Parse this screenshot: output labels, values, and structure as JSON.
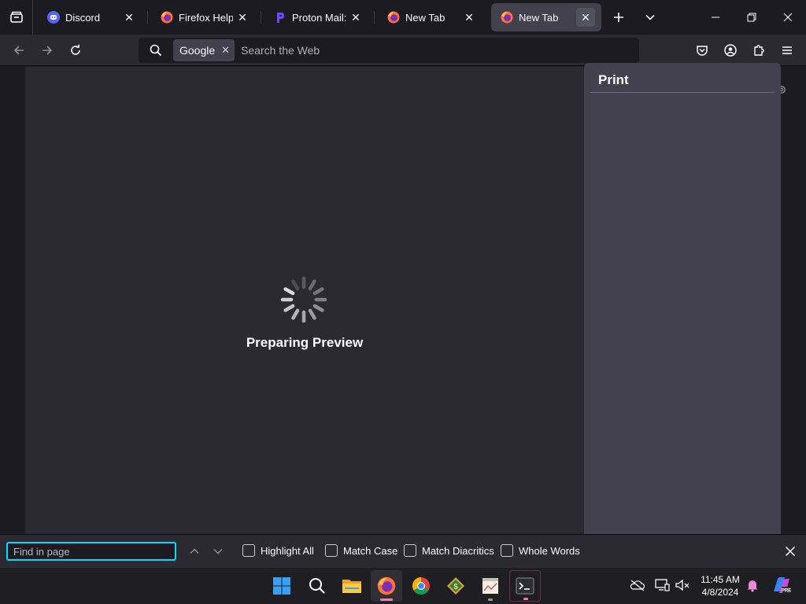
{
  "tabs": [
    {
      "title": "Discord",
      "icon": "discord-icon",
      "active": false
    },
    {
      "title": "Firefox Help",
      "icon": "firefox-icon",
      "active": false
    },
    {
      "title": "Proton Mail: Sig",
      "icon": "proton-icon",
      "active": false
    },
    {
      "title": "New Tab",
      "icon": "firefox-icon",
      "active": false
    },
    {
      "title": "New Tab",
      "icon": "firefox-icon",
      "active": true
    }
  ],
  "urlbar": {
    "engine": "Google",
    "placeholder": "Search the Web"
  },
  "print_panel": {
    "title": "Print"
  },
  "preview": {
    "status": "Preparing Preview"
  },
  "findbar": {
    "placeholder": "Find in page",
    "options": [
      {
        "label": "Highlight All",
        "checked": false
      },
      {
        "label": "Match Case",
        "checked": false
      },
      {
        "label": "Match Diacritics",
        "checked": false
      },
      {
        "label": "Whole Words",
        "checked": false
      }
    ]
  },
  "taskbar": {
    "apps": [
      "windows-start-icon",
      "search-icon",
      "file-explorer-icon",
      "firefox-icon",
      "chrome-icon",
      "money-app-icon",
      "notepad-icon",
      "terminal-icon"
    ],
    "time": "11:45 AM",
    "date": "4/8/2024"
  },
  "colors": {
    "accent": "#00ddff",
    "tab_active": "#42414d",
    "toolbar": "#2b2a33",
    "frame": "#1c1b22"
  }
}
